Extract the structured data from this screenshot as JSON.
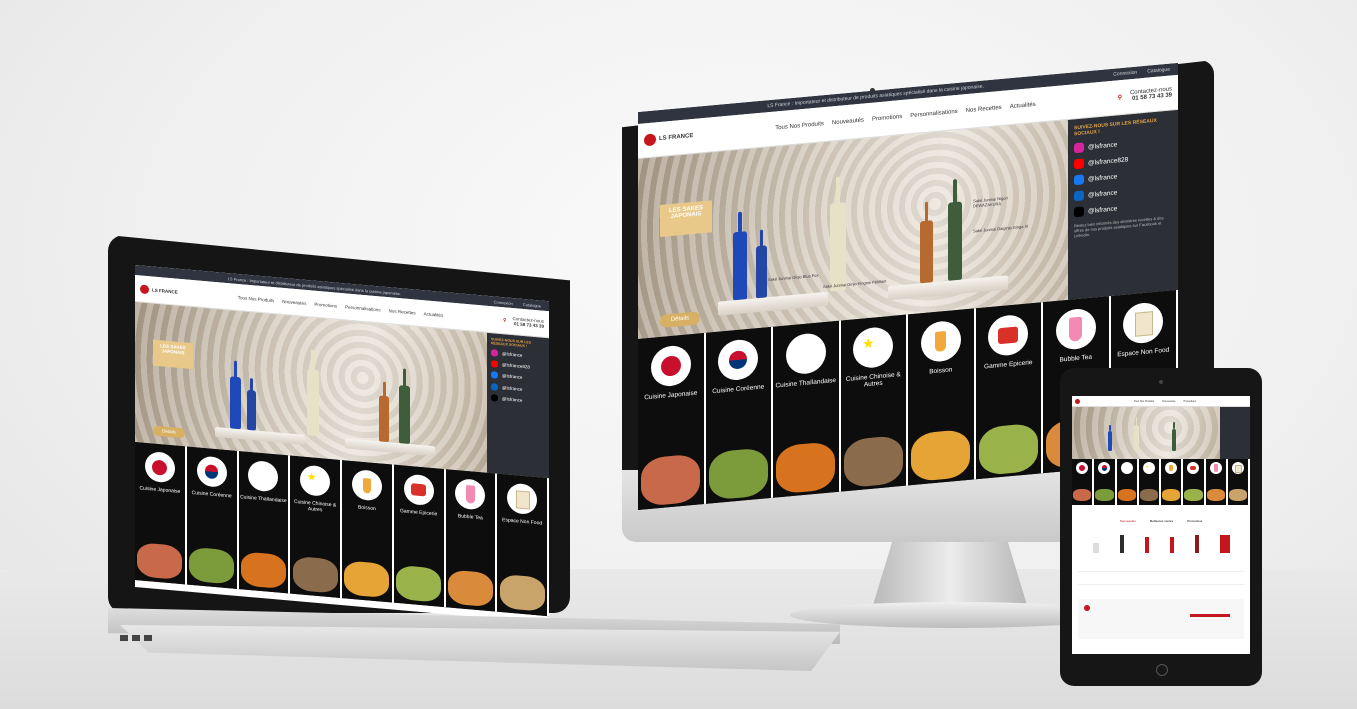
{
  "site": {
    "logo_text": "LS FRANCE",
    "topbar_message": "LS France : Importateur et distributeur de produits asiatiques spécialisé dans la cuisine japonaise.",
    "topbar_links": [
      "Connexion",
      "Catalogue"
    ],
    "nav_items": [
      "Tous Nos Produits",
      "Nouveautés",
      "Promotions",
      "Personnalisations",
      "Nos Recettes",
      "Actualités"
    ],
    "contact_label": "Contactez-nous",
    "contact_phone": "01 58 73 43 39"
  },
  "hero": {
    "badge": "LES SAKES JAPONAIS",
    "details_button": "Détails",
    "bottle_captions": [
      "Saké Junmai Ginjo Blue Fox",
      "Saké Junmai Ginjo Kingnin Pétillant",
      "Saké Junmai Daiginjo Ginga III",
      "Saké Junmai Nigori DEWAZAKURA"
    ]
  },
  "social": {
    "heading": "SUIVEZ-NOUS SUR LES RÉSEAUX SOCIAUX !",
    "items": [
      {
        "icon": "instagram-icon",
        "handle": "@lsfrance",
        "color": "#d6249f"
      },
      {
        "icon": "youtube-icon",
        "handle": "@lsfrance828",
        "color": "#ff0000"
      },
      {
        "icon": "facebook-icon",
        "handle": "@lsfrance",
        "color": "#1877f2"
      },
      {
        "icon": "linkedin-icon",
        "handle": "@lsfrance",
        "color": "#0a66c2"
      },
      {
        "icon": "tiktok-icon",
        "handle": "@lsfrance",
        "color": "#000000"
      }
    ],
    "blurb": "Restez bien informés des dernières recettes & des offres de nos produits asiatiques sur Facebook et LinkedIn."
  },
  "categories": [
    {
      "name": "Cuisine Japonaise",
      "icon": "japan-flag-icon",
      "food": "#c86a4a"
    },
    {
      "name": "Cuisine Coréenne",
      "icon": "korea-flag-icon",
      "food": "#7c9b3a"
    },
    {
      "name": "Cuisine Thaïlandaise",
      "icon": "thailand-flag-icon",
      "food": "#d7721f"
    },
    {
      "name": "Cuisine Chinoise & Autres",
      "icon": "china-flag-icon",
      "food": "#8a6b4c"
    },
    {
      "name": "Boisson",
      "icon": "drink-icon",
      "food": "#e6a436"
    },
    {
      "name": "Gamme Epicerie",
      "icon": "grocery-icon",
      "food": "#9ab24a"
    },
    {
      "name": "Bubble Tea",
      "icon": "bubble-tea-icon",
      "food": "#d98a3a"
    },
    {
      "name": "Espace Non Food",
      "icon": "takeaway-box-icon",
      "food": "#c9a46a"
    }
  ],
  "tablet": {
    "tabs": [
      "Nouveautés",
      "Meilleures ventes",
      "Promotions"
    ]
  }
}
